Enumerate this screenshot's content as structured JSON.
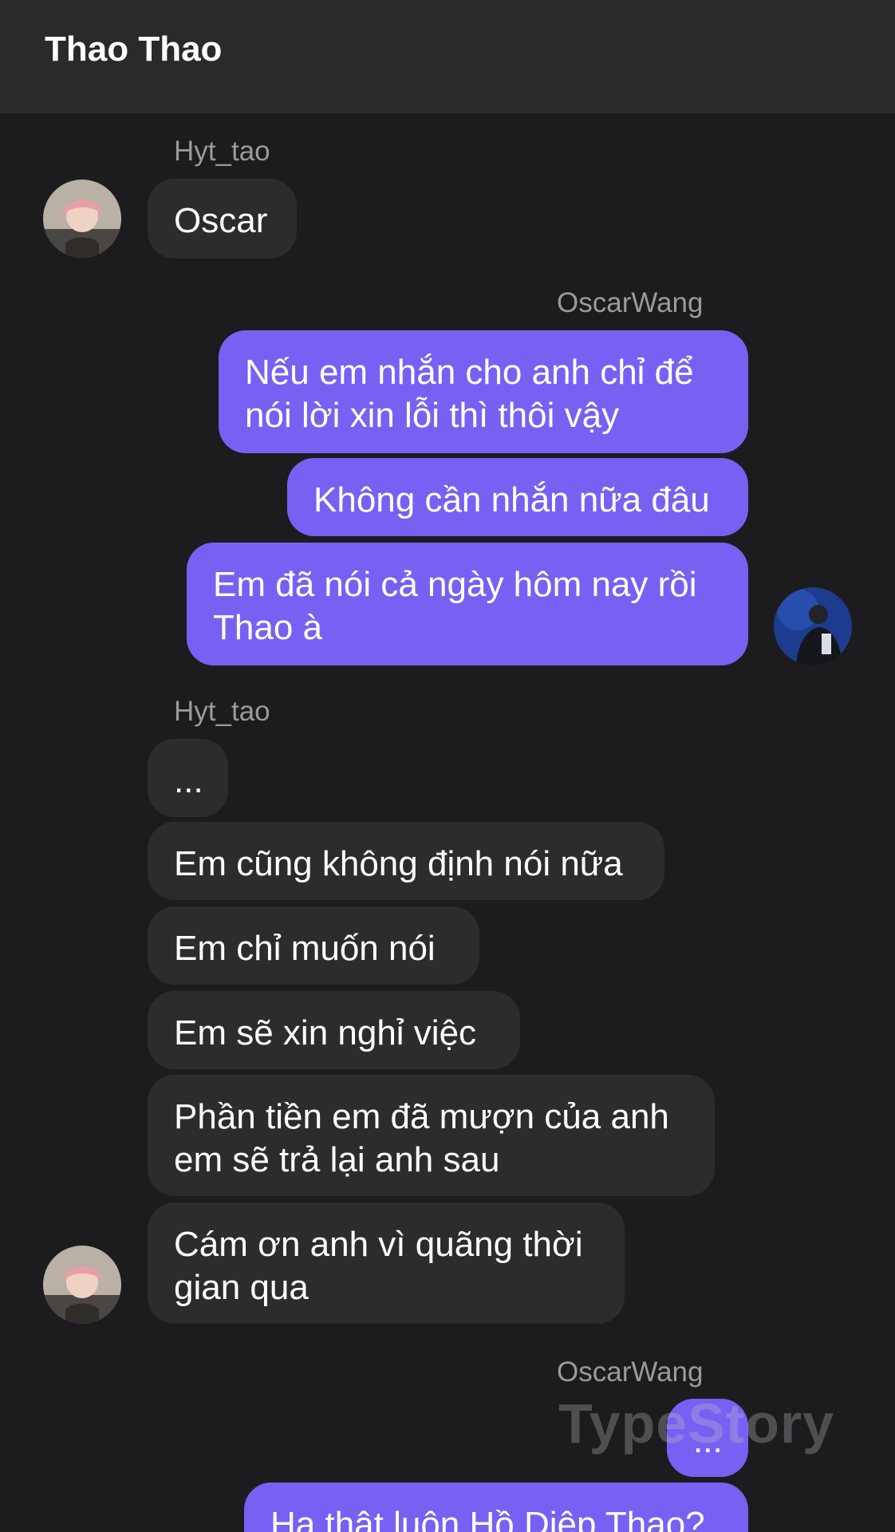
{
  "header": {
    "title": "Thao Thao"
  },
  "users": {
    "left": "Hyt_tao",
    "right": "OscarWang"
  },
  "messages": {
    "m1": "Oscar",
    "m2_line1": "Nếu em nhắn cho anh chỉ để",
    "m2_line2": "nói lời xin lỗi thì thôi vậy",
    "m3": "Không cần nhắn nữa đâu",
    "m4_line1": "Em đã nói cả ngày hôm nay rồi",
    "m4_line2": "Thao à",
    "m5": "...",
    "m6": "Em cũng không định nói nữa",
    "m7": "Em chỉ muốn nói",
    "m8": "Em sẽ xin nghỉ việc",
    "m9_line1": "Phần tiền em đã mượn của anh",
    "m9_line2": "em sẽ trả lại anh sau",
    "m10_line1": "Cám ơn anh vì quãng thời",
    "m10_line2": "gian qua",
    "m11": "...",
    "m12": "Hạ thật luôn Hồ Diệp Thao?"
  },
  "watermark": "TypeStory",
  "icons": {
    "left_avatar": "avatar-pink-hair",
    "right_avatar": "avatar-dark-portrait"
  },
  "colors": {
    "background": "#1c1c1e",
    "header": "#2a2a2c",
    "incoming_bubble": "#2c2c2e",
    "outgoing_bubble": "#7761f3",
    "sender_name": "#9a9a9e"
  }
}
